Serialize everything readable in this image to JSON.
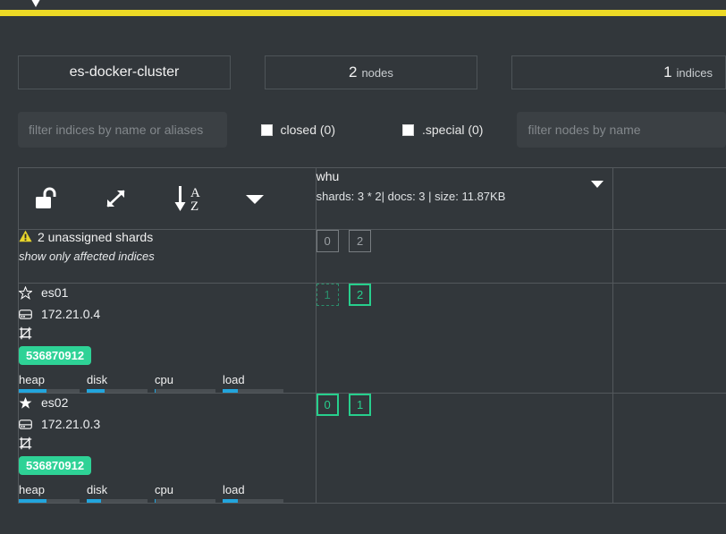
{
  "header": {
    "logo_icon": "chevron-down-logo",
    "accent_bar_color": "#ecd925"
  },
  "cluster": {
    "name": "es-docker-cluster",
    "nodes_count": "2",
    "nodes_label": "nodes",
    "indices_count": "1",
    "indices_label": "indices"
  },
  "filters": {
    "indices_placeholder": "filter indices by name or aliases",
    "indices_value": "",
    "nodes_placeholder": "filter nodes by name",
    "nodes_value": "",
    "closed_label": "closed (0)",
    "special_label": ".special (0)"
  },
  "toolbar": {
    "lock_icon": "unlock-icon",
    "expand_icon": "expand-arrows-icon",
    "sort_icon": "sort-alpha-az-icon",
    "more_icon": "chevron-down-icon"
  },
  "indices": [
    {
      "name": "whu",
      "meta": "shards: 3 * 2| docs: 3 | size: 11.87KB",
      "caret_icon": "chevron-down-icon"
    }
  ],
  "unassigned": {
    "warning_icon": "warning-triangle-icon",
    "title": "2 unassigned shards",
    "link": "show only affected indices",
    "shards": [
      {
        "label": "0",
        "state": "unassigned"
      },
      {
        "label": "2",
        "state": "unassigned"
      }
    ]
  },
  "nodes": [
    {
      "name": "es01",
      "master": false,
      "star_icon": "star-outline-icon",
      "host_icon": "hdd-icon",
      "host": "172.21.0.4",
      "data_icon": "data-node-icon",
      "memory": "536870912",
      "metrics": [
        {
          "label": "heap",
          "percent": 45
        },
        {
          "label": "disk",
          "percent": 30
        },
        {
          "label": "cpu",
          "percent": 2
        },
        {
          "label": "load",
          "percent": 25
        }
      ],
      "shards": [
        {
          "label": "1",
          "state": "relocating"
        },
        {
          "label": "2",
          "state": "assigned"
        }
      ]
    },
    {
      "name": "es02",
      "master": true,
      "star_icon": "star-filled-icon",
      "host_icon": "hdd-icon",
      "host": "172.21.0.3",
      "data_icon": "data-node-icon",
      "memory": "536870912",
      "metrics": [
        {
          "label": "heap",
          "percent": 45
        },
        {
          "label": "disk",
          "percent": 24
        },
        {
          "label": "cpu",
          "percent": 2
        },
        {
          "label": "load",
          "percent": 25
        }
      ],
      "shards": [
        {
          "label": "0",
          "state": "assigned"
        },
        {
          "label": "1",
          "state": "assigned"
        }
      ]
    }
  ],
  "colors": {
    "background": "#32373b",
    "accent_yellow": "#ecd925",
    "shard_green": "#27cf8d",
    "badge_green": "#2ed296",
    "metric_blue": "#22a5dd",
    "warning_yellow": "#e8d52b"
  }
}
